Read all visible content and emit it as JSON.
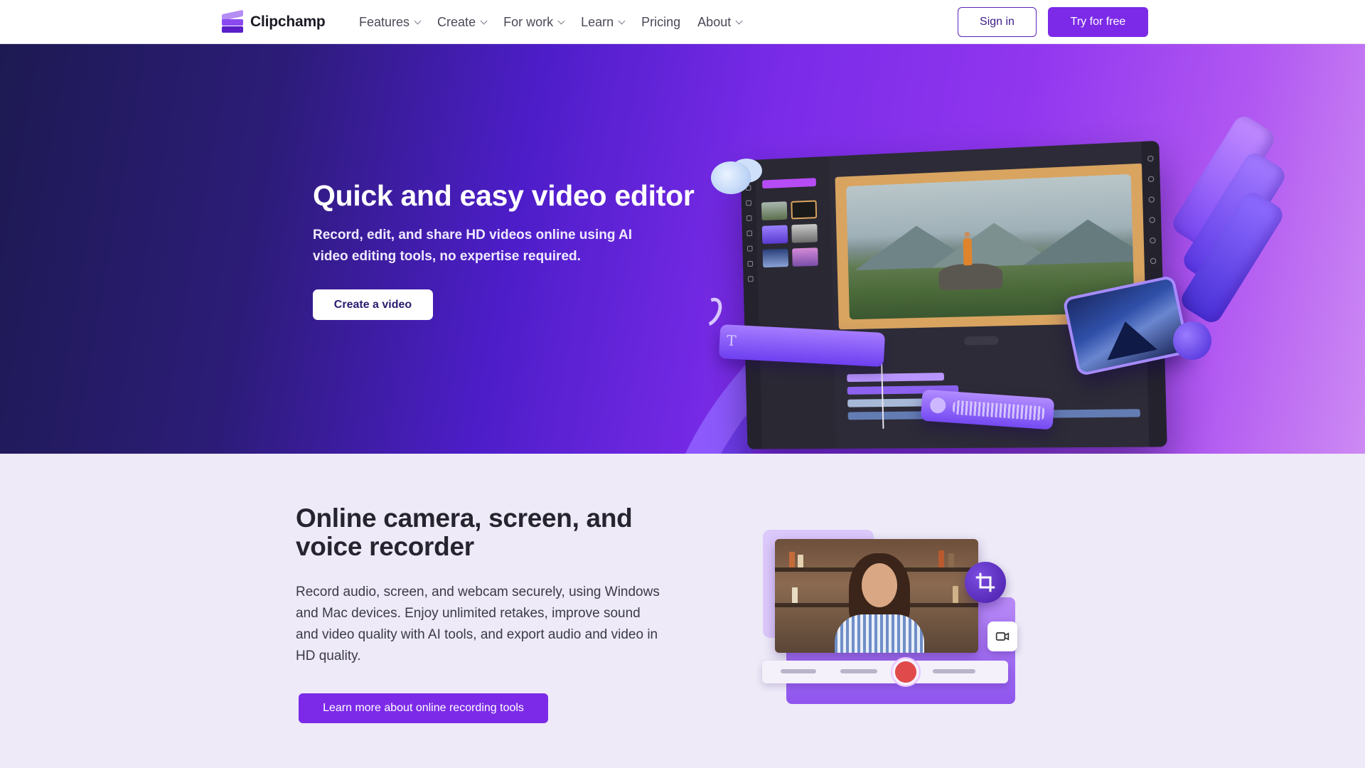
{
  "brand": {
    "name": "Clipchamp"
  },
  "nav": {
    "items": [
      {
        "label": "Features",
        "dropdown": true
      },
      {
        "label": "Create",
        "dropdown": true
      },
      {
        "label": "For work",
        "dropdown": true
      },
      {
        "label": "Learn",
        "dropdown": true
      },
      {
        "label": "Pricing",
        "dropdown": false
      },
      {
        "label": "About",
        "dropdown": true
      }
    ],
    "sign_in": "Sign in",
    "try_free": "Try for free"
  },
  "hero": {
    "title": "Quick and easy video editor",
    "subtitle": "Record, edit, and share HD videos online using AI video editing tools, no expertise required.",
    "cta": "Create a video"
  },
  "recorder": {
    "title": "Online camera, screen, and voice recorder",
    "body": "Record audio, screen, and webcam securely, using Windows and Mac devices. Enjoy unlimited retakes, improve sound and video quality with AI tools, and export audio and video in HD quality.",
    "cta": "Learn more about online recording tools"
  },
  "colors": {
    "accent": "#7c2ae8",
    "hero_dark": "#1d1a52",
    "hero_light": "#cd8af3",
    "section_bg": "#eeeaf8",
    "record_red": "#e04a4a"
  },
  "icons": [
    "clipchamp-logo-icon",
    "chevron-down-icon",
    "text-icon",
    "play-icon",
    "crop-icon",
    "camera-icon",
    "record-icon",
    "microphone-icon"
  ]
}
